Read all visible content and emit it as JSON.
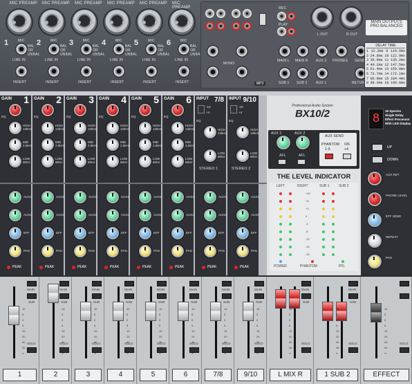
{
  "top_panel": {
    "mic_labels": [
      "MIC PREAMP",
      "MIC PREAMP",
      "MIC PREAMP",
      "MIC PREAMP",
      "MIC PREAMP",
      "MIC PREAMP"
    ],
    "channel_numbers": [
      "1",
      "2",
      "3",
      "4",
      "5",
      "6"
    ],
    "mic_tag": "MIC",
    "line_in_tag": "LINE IN",
    "insert_tag": "INSERT",
    "bal_unbal": "BAL OR UNBAL",
    "mono_label": "MONO",
    "mp3_label": "MP3",
    "rec_label": "REC",
    "play_label": "PLAY",
    "l_out": "L OUT",
    "r_out": "R OUT",
    "main_outputs": "MAIN OUTPUTS",
    "main_outputs_sub": "PRO BALANCED",
    "out_jacks": [
      "MAIN L",
      "MAIN R",
      "AUX 2",
      "PHONES",
      "SEND",
      "SUB 1",
      "SUB 2",
      "AUX 1",
      "RETURN"
    ],
    "delay_title": "DELAY TIME",
    "delay_rows": [
      [
        "1",
        "12.3ms",
        "9",
        "110.6ms"
      ],
      [
        "2",
        "24.6ms",
        "10",
        "122.9ms"
      ],
      [
        "3",
        "36.9ms",
        "11",
        "135.2ms"
      ],
      [
        "4",
        "49.2ms",
        "12",
        "147.5ms"
      ],
      [
        "5",
        "61.4ms",
        "13",
        "159.8ms"
      ],
      [
        "6",
        "73.7ms",
        "14",
        "172.1ms"
      ],
      [
        "7",
        "86.0ms",
        "15",
        "184.4ms"
      ],
      [
        "8",
        "98.3ms",
        "16",
        "196.6ms"
      ]
    ]
  },
  "channels": {
    "gain_label": "GAIN",
    "eq_label": "EQ",
    "high_label": "HIGH 12kHz",
    "mid_label": "MID 2.5kHz",
    "low_label": "LOW 80Hz",
    "aux1_label": "AUX1",
    "aux2_label": "AUX2",
    "eff_label": "EFF",
    "pan_label": "PAN",
    "peak_label": "PEAK",
    "mono_numbers": [
      "1",
      "2",
      "3",
      "4",
      "5",
      "6"
    ],
    "stereo_numbers": [
      "7/8",
      "9/10"
    ],
    "input_label": "INPUT",
    "stereo_labels": [
      "STEREO 1",
      "STEREO 2"
    ],
    "level_marks": [
      "-10",
      "+4"
    ]
  },
  "master": {
    "brand_sub": "Professional Audio System",
    "brand": "BX10/2",
    "aux_send": "AUX SEND",
    "aux1": "AUX 1",
    "aux2": "AUX 2",
    "afl": "AFL",
    "phantom": "PHANTOM",
    "on": "ON",
    "phantom_range": "1-6",
    "on_range": "+4",
    "level_indicator": "THE LEVEL INDICATOR",
    "meter_cols": [
      "LEFT",
      "RIGHT",
      "SUB 1",
      "SUB 2"
    ],
    "db_marks": [
      "+10",
      "+6",
      "+3",
      "0",
      "-3",
      "-6",
      "-10",
      "-20",
      "-30"
    ],
    "power": "POWER",
    "phantom_led": "PHANTOM",
    "pfl": "PFL"
  },
  "effect": {
    "display_value": "8",
    "info": "16 Species Single Delay Effect Processor With LED Display",
    "up": "UP",
    "down": "DOWN",
    "knob_labels": [
      "AUX RET",
      "PHONE LEVEL",
      "EFF SEND",
      "REPEAT",
      "PAN"
    ]
  },
  "faders": {
    "main": "MAIN",
    "sub": "SUB",
    "solo": "SOLO",
    "scale": [
      "10",
      "5",
      "0",
      "5",
      "10",
      "20",
      "30",
      "40",
      "∞"
    ],
    "names": [
      "1",
      "2",
      "3",
      "4",
      "5",
      "6",
      "7/8",
      "9/10",
      "L  MIX  R",
      "1  SUB  2",
      "EFFECT"
    ]
  }
}
